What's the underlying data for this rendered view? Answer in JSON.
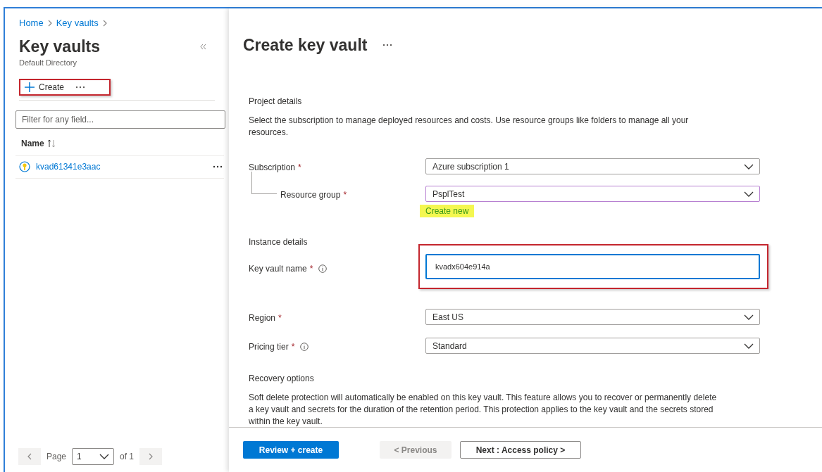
{
  "breadcrumb": [
    "Home",
    "Key vaults"
  ],
  "list_panel": {
    "title": "Key vaults",
    "subtitle": "Default Directory",
    "toolbar": {
      "create_label": "Create",
      "highlighted": true
    },
    "filter": {
      "placeholder": "Filter for any field..."
    },
    "columns": [
      {
        "label": "Name",
        "sortable": true
      }
    ],
    "rows": [
      {
        "name": "kvad61341e3aac"
      }
    ],
    "pagination": {
      "label": "Page",
      "page": "1",
      "of": "of 1",
      "previous_disabled": true,
      "next_disabled": true
    }
  },
  "form": {
    "title": "Create key vault",
    "sections": [
      {
        "heading": "Project details",
        "description": "Select the subscription to manage deployed resources and costs. Use resource groups like folders to manage all your resources.",
        "fields": [
          {
            "kind": "select",
            "label": "Subscription",
            "required_mark": "*",
            "value": "Azure subscription 1",
            "focused": false,
            "children": [
              {
                "kind": "select",
                "label": "Resource group",
                "required_mark": "*",
                "value": "PsplTest",
                "focused": true,
                "link": {
                  "label": "Create new",
                  "highlighted": true
                }
              }
            ]
          }
        ]
      },
      {
        "heading": "Instance details",
        "fields": [
          {
            "kind": "text",
            "label": "Key vault name",
            "required_mark": "*",
            "info": true,
            "value": "kvadx604e914a",
            "focused": true,
            "highlighted": true
          },
          {
            "kind": "select",
            "label": "Region",
            "required_mark": "*",
            "value": "East US",
            "focused": false
          },
          {
            "kind": "select",
            "label": "Pricing tier",
            "required_mark": "*",
            "info": true,
            "value": "Standard",
            "focused": false
          }
        ]
      },
      {
        "heading": "Recovery options",
        "description": "Soft delete protection will automatically be enabled on this key vault. This feature allows you to recover or permanently delete a key vault and secrets for the duration of the retention period. This protection applies to the key vault and the secrets stored within the key vault."
      }
    ]
  },
  "footer_buttons": [
    {
      "kind": "primary",
      "label": "Review + create"
    },
    {
      "kind": "secondary",
      "label": "< Previous",
      "disabled": true
    },
    {
      "kind": "secondary",
      "label": "Next : Access policy >",
      "disabled": false
    }
  ]
}
